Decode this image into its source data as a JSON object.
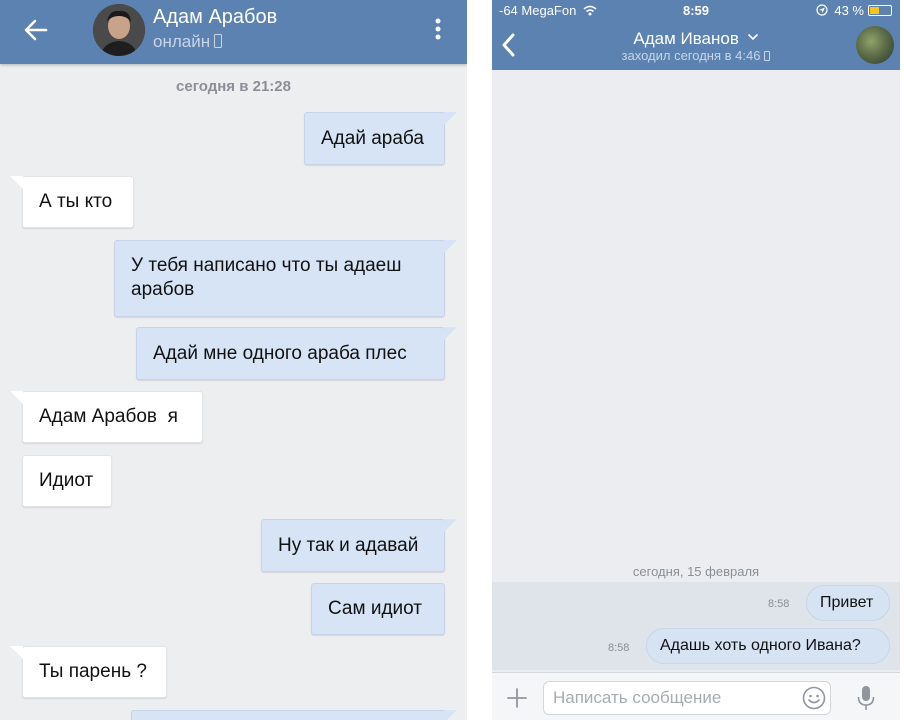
{
  "left": {
    "contact_name": "Адам Арабов",
    "status": "онлайн",
    "date": "сегодня в 21:28",
    "messages": [
      {
        "dir": "out",
        "text": "Адай араба"
      },
      {
        "dir": "in",
        "text": "А ты кто"
      },
      {
        "dir": "out",
        "text": "У тебя написано что ты адаеш арабов"
      },
      {
        "dir": "out",
        "text": "Адай мне одного араба плес"
      },
      {
        "dir": "in",
        "text": "Адам Арабов  я"
      },
      {
        "dir": "in",
        "text": "Идиот"
      },
      {
        "dir": "out",
        "text": "Ну так и адавай"
      },
      {
        "dir": "out",
        "text": "Сам идиот"
      },
      {
        "dir": "in",
        "text": "Ты парень ?"
      }
    ],
    "colors": {
      "header": "#5b82b0",
      "outgoing": "#d6e4f5",
      "incoming": "#ffffff",
      "background": "#edeef0"
    },
    "icons": [
      "arrow-left-icon",
      "more-vertical-icon",
      "phone-icon"
    ]
  },
  "right": {
    "status_bar": {
      "carrier": "-64 MegaFon",
      "time": "8:59",
      "battery": "43 %",
      "battery_level": 0.43
    },
    "contact_name": "Адам Иванов",
    "last_seen": "заходил сегодня в 4:46",
    "date": "сегодня, 15 февраля",
    "messages": [
      {
        "dir": "out",
        "time": "8:58",
        "text": "Привет"
      },
      {
        "dir": "out",
        "time": "8:58",
        "text": "Адашь хоть одного Ивана?"
      }
    ],
    "input_placeholder": "Написать сообщение",
    "colors": {
      "header": "#5b82b0",
      "outgoing": "#d6e3f3",
      "background": "#ebedf0"
    },
    "icons": [
      "chevron-left-icon",
      "chevron-down-icon",
      "wifi-icon",
      "location-icon",
      "battery-icon",
      "plus-icon",
      "smile-icon",
      "mic-icon"
    ]
  }
}
